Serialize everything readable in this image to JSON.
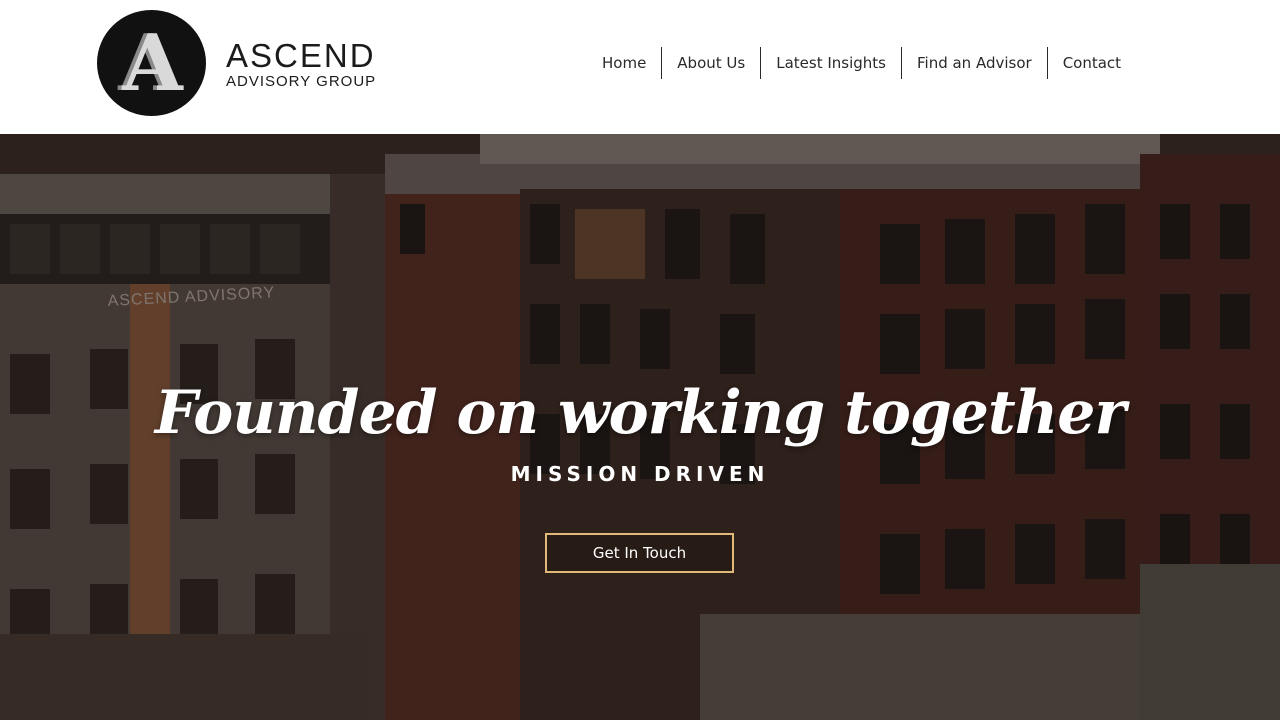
{
  "brand": {
    "logo_letter": "A",
    "name": "ASCEND",
    "subtitle": "ADVISORY GROUP"
  },
  "nav": {
    "items": [
      {
        "label": "Home"
      },
      {
        "label": "About Us"
      },
      {
        "label": "Latest Insights"
      },
      {
        "label": "Find an Advisor"
      },
      {
        "label": "Contact"
      }
    ]
  },
  "hero": {
    "background_sign": "ASCEND ADVISORY",
    "headline": "Founded on working together",
    "subheadline": "MISSION DRIVEN",
    "cta_label": "Get In Touch"
  },
  "colors": {
    "accent_border": "#e2b77a",
    "logo_circle": "#111111",
    "header_bg": "#ffffff",
    "text_dark": "#1b1b1b"
  }
}
